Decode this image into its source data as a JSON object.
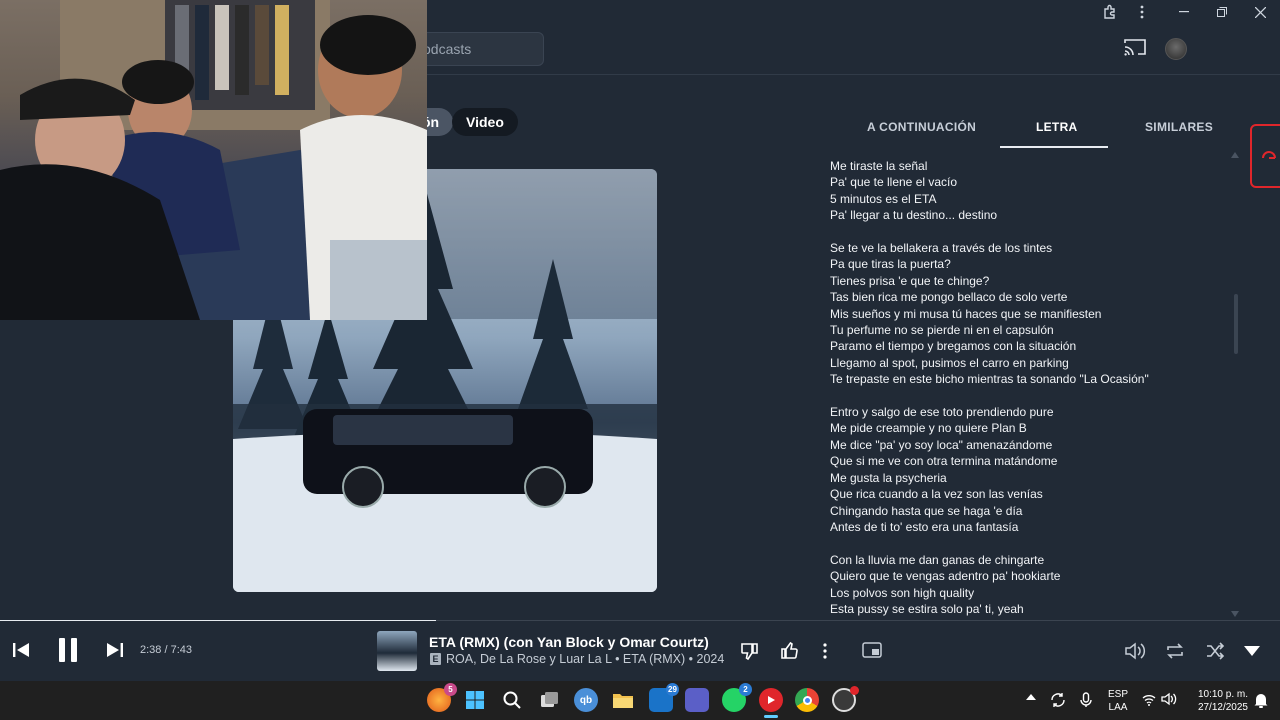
{
  "header": {
    "search_placeholder": "odcasts"
  },
  "chips": {
    "partial": "ón",
    "video": "Video"
  },
  "tabs": [
    {
      "label": "A CONTINUACIÓN"
    },
    {
      "label": "LETRA"
    },
    {
      "label": "SIMILARES"
    }
  ],
  "lyrics": [
    [
      "Me tiraste la señal",
      "Pa' que te llene el vacío",
      "5 minutos es el ETA",
      "Pa' llegar a tu destino... destino"
    ],
    [
      "Se te ve la bellakera a través de los tintes",
      "Pa que tiras la puerta?",
      "Tienes prisa 'e que te chinge?",
      "Tas bien rica me pongo bellaco de solo verte",
      "Mis sueños y mi musa tú haces que se manifiesten",
      "Tu perfume no se pierde ni en el capsulón",
      "Paramo el tiempo y bregamos con la situación",
      "Llegamo al spot, pusimos el carro en parking",
      "Te trepaste en este bicho mientras ta sonando \"La Ocasión\""
    ],
    [
      "Entro y salgo de ese toto prendiendo pure",
      "Me pide creampie y no quiere Plan B",
      "Me dice \"pa' yo soy loca\" amenazándome",
      "Que si me ve con otra termina matándome",
      "Me gusta la psycheria",
      "Que rica cuando a la vez son las venías",
      "Chingando hasta que se haga 'e día",
      "Antes de ti to' esto era una fantasía"
    ],
    [
      "Con la lluvia me dan ganas de chingarte",
      "Quiero que te vengas adentro pa' hookiarte",
      "Los polvos son high quality",
      "Esta pussy se estira solo pa' ti, yeah"
    ]
  ],
  "player": {
    "time": "2:38 / 7:43",
    "progress": 0.341,
    "song_title": "ETA (RMX) (con Yan Block y Omar Courtz)",
    "explicit_badge": "E",
    "song_subtitle": "ROA, De La Rose y Luar La L • ETA (RMX) • 2024"
  },
  "taskbar": {
    "badges": {
      "firefox": "5",
      "mail": "29",
      "whatsapp": "2"
    },
    "language": "ESP",
    "language_sub": "LAA",
    "time": "10:10 p. m.",
    "date": "27/12/2025"
  },
  "colors": {
    "background": "#212a36",
    "accent": "#e8ecf1",
    "taskbar": "#202020",
    "youtube_red": "#e0262b"
  }
}
